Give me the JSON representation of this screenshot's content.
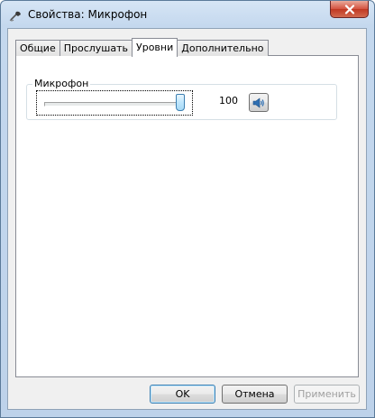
{
  "window": {
    "title": "Свойства: Микрофон",
    "icon": "microphone-icon",
    "close_icon": "close-icon"
  },
  "tabs": [
    {
      "label": "Общие",
      "active": false
    },
    {
      "label": "Прослушать",
      "active": false
    },
    {
      "label": "Уровни",
      "active": true
    },
    {
      "label": "Дополнительно",
      "active": false
    }
  ],
  "levels": {
    "group_label": "Микрофон",
    "slider_value": 100,
    "slider_max": 100,
    "value_text": "100",
    "mute_icon": "speaker-icon"
  },
  "buttons": {
    "ok": "OK",
    "cancel": "Отмена",
    "apply": "Применить"
  },
  "colors": {
    "accent": "#3c7fb1",
    "close_red": "#c03822"
  }
}
